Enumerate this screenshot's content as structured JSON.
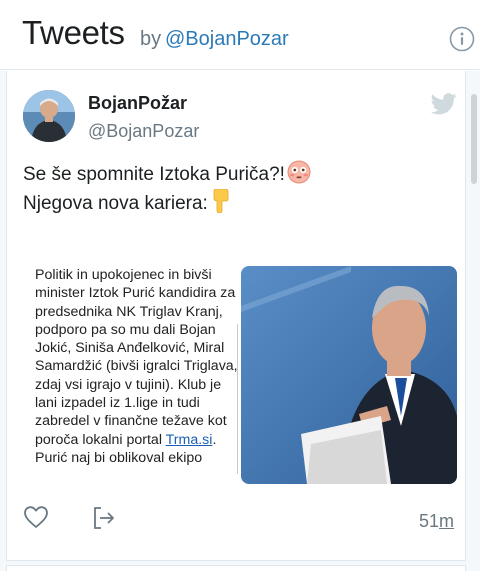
{
  "header": {
    "title": "Tweets",
    "by": "by",
    "handle": "@BojanPozar"
  },
  "tweet": {
    "author_name": "BojanPožar",
    "author_handle": "@BojanPozar",
    "text_line1": "Se še spomnite Iztoka Puriča?!",
    "text_line2": "Njegova nova kariera:",
    "media_text": "Politik in upokojenec in bivši minister  Iztok Purić kandidira za predsednika NK Triglav Kranj, podporo pa so mu dali Bojan Jokić, Siniša Anđelković, Miral Samardžić (bivši igralci Triglava, zdaj vsi igrajo v tujini). Klub je lani izpadel iz 1.lige in tudi zabredel v finančne težave kot poroča lokalni portal ",
    "media_link": "Trma.si",
    "media_text_after": ". Purić naj bi oblikoval ekipo",
    "time_value": "51",
    "time_unit": "m"
  },
  "colors": {
    "link": "#2b7bb9",
    "muted": "#697882",
    "divider": "#e1e8ed"
  },
  "icons": [
    "info-icon",
    "twitter-bird-icon",
    "heart-icon",
    "share-icon",
    "flushed-face-emoji",
    "pointing-down-emoji"
  ]
}
